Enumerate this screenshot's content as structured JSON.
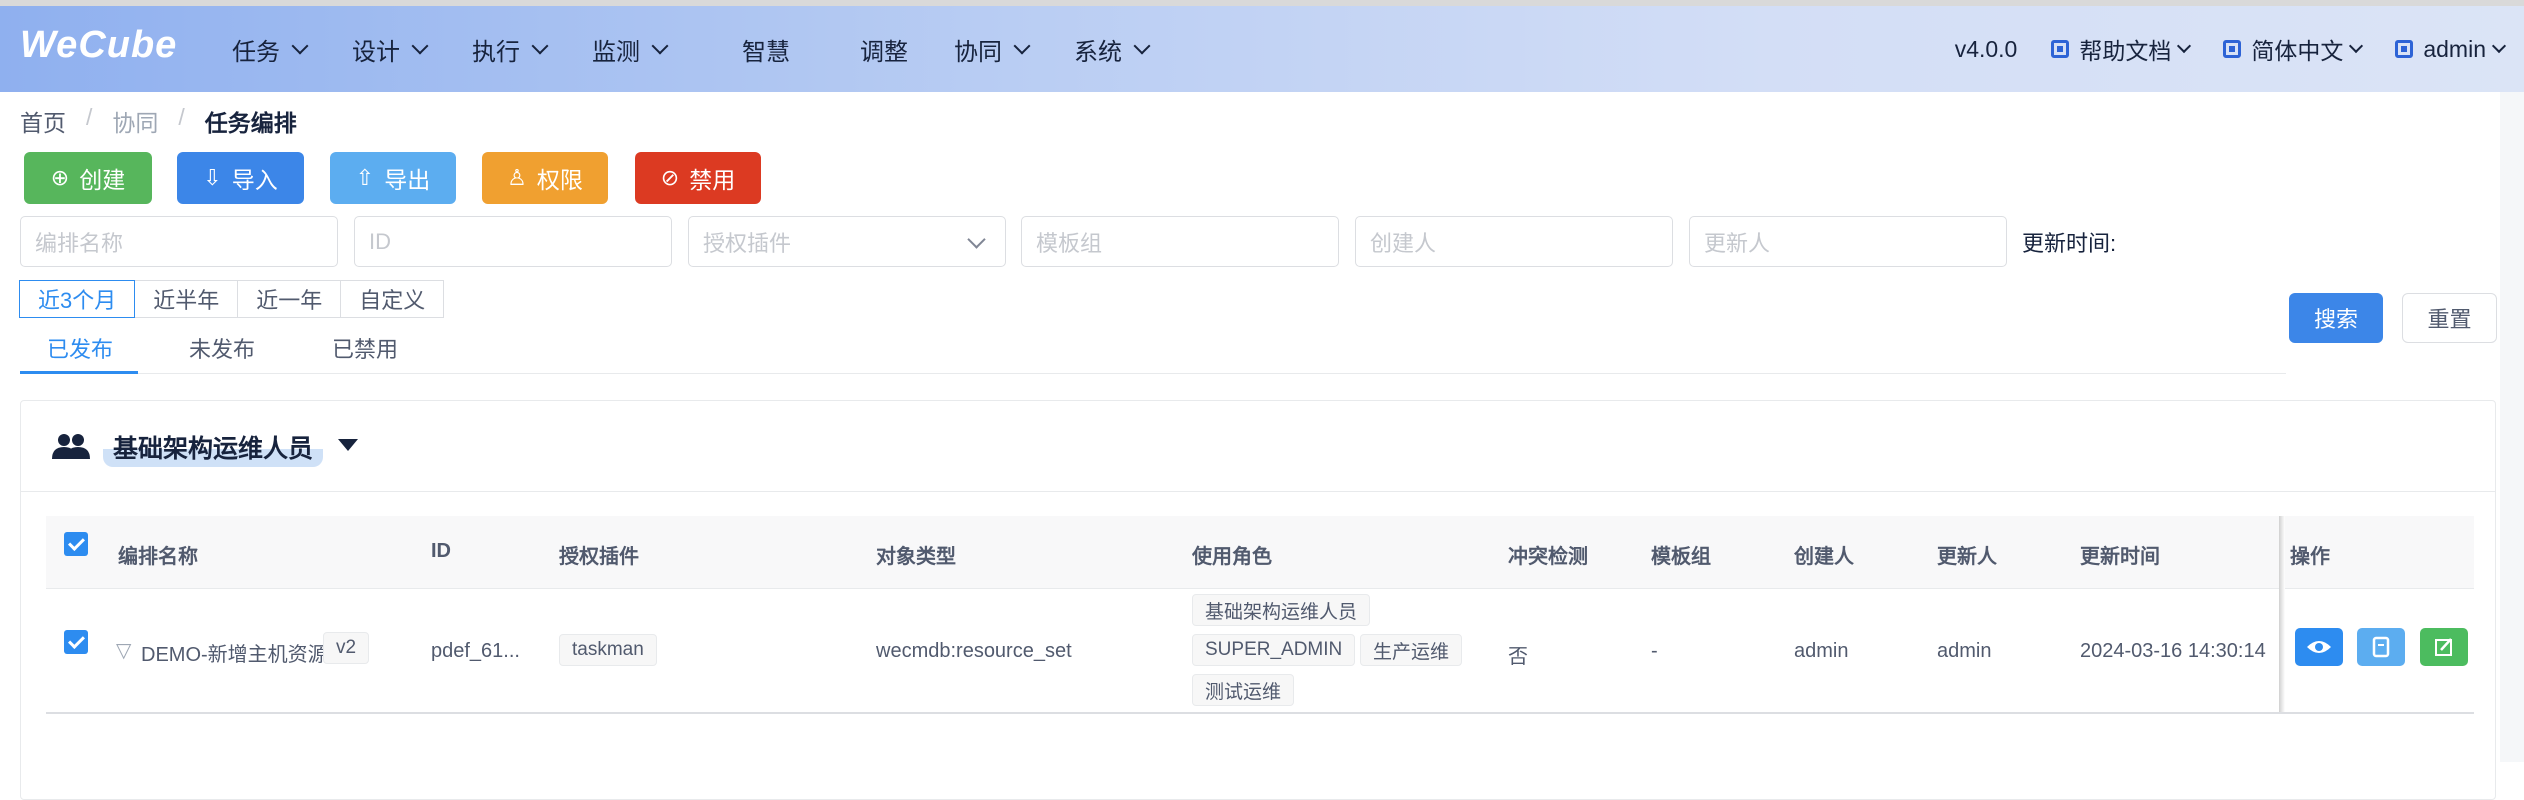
{
  "header": {
    "logo": "WeCube",
    "nav": [
      {
        "label": "任务",
        "dropdown": true
      },
      {
        "label": "设计",
        "dropdown": true
      },
      {
        "label": "执行",
        "dropdown": true
      },
      {
        "label": "监测",
        "dropdown": true
      },
      {
        "label": "智慧",
        "dropdown": false
      },
      {
        "label": "调整",
        "dropdown": false
      },
      {
        "label": "协同",
        "dropdown": true
      },
      {
        "label": "系统",
        "dropdown": true
      }
    ],
    "version": "v4.0.0",
    "help": "帮助文档",
    "language": "简体中文",
    "user": "admin"
  },
  "breadcrumb": {
    "home": "首页",
    "parent": "协同",
    "current": "任务编排"
  },
  "toolbar": {
    "create": "创建",
    "import": "导入",
    "export": "导出",
    "permission": "权限",
    "disable": "禁用"
  },
  "filters": {
    "name_placeholder": "编排名称",
    "id_placeholder": "ID",
    "plugin_placeholder": "授权插件",
    "template_placeholder": "模板组",
    "creator_placeholder": "创建人",
    "updater_placeholder": "更新人",
    "time_label": "更新时间:",
    "time_ranges": [
      "近3个月",
      "近半年",
      "近一年",
      "自定义"
    ],
    "search": "搜索",
    "reset": "重置"
  },
  "tabs": [
    "已发布",
    "未发布",
    "已禁用"
  ],
  "group": {
    "title": "基础架构运维人员"
  },
  "table": {
    "columns": [
      "编排名称",
      "ID",
      "授权插件",
      "对象类型",
      "使用角色",
      "冲突检测",
      "模板组",
      "创建人",
      "更新人",
      "更新时间",
      "操作"
    ],
    "rows": [
      {
        "name": "DEMO-新增主机资源",
        "version": "v2",
        "id": "pdef_61...",
        "plugin": "taskman",
        "object_type": "wecmdb:resource_set",
        "roles": [
          "基础架构运维人员",
          "SUPER_ADMIN",
          "生产运维",
          "测试运维"
        ],
        "conflict": "否",
        "template": "-",
        "creator": "admin",
        "updater": "admin",
        "updated": "2024-03-16 14:30:14"
      }
    ]
  },
  "colors": {
    "create": "#57b65c",
    "import": "#3c86e8",
    "export": "#5cadf0",
    "permission": "#f0a030",
    "disable": "#dc3a22",
    "view": "#2d8cf0",
    "copy": "#5cadf0",
    "edit": "#4cbc5f"
  }
}
